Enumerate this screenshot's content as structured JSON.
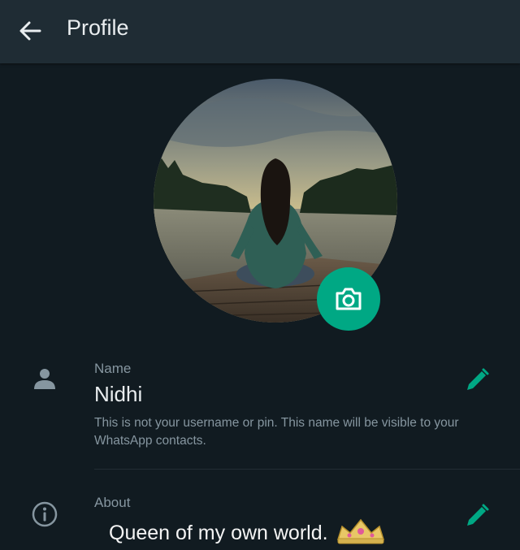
{
  "header": {
    "title": "Profile",
    "back_icon": "arrow-left-icon"
  },
  "profile_photo": {
    "camera_icon": "camera-icon",
    "accent": "#00a884"
  },
  "name_section": {
    "icon": "person-icon",
    "label": "Name",
    "value": "Nidhi",
    "hint": "This is not your username or pin. This name will be visible to your WhatsApp contacts.",
    "edit_icon": "pencil-icon"
  },
  "about_section": {
    "icon": "info-icon",
    "label": "About",
    "value": "Queen of my own world.",
    "emoji": "crown-icon",
    "edit_icon": "pencil-icon"
  },
  "colors": {
    "background": "#111b21",
    "header": "#1f2c34",
    "accent": "#00a884",
    "secondary_text": "#8696a0"
  }
}
